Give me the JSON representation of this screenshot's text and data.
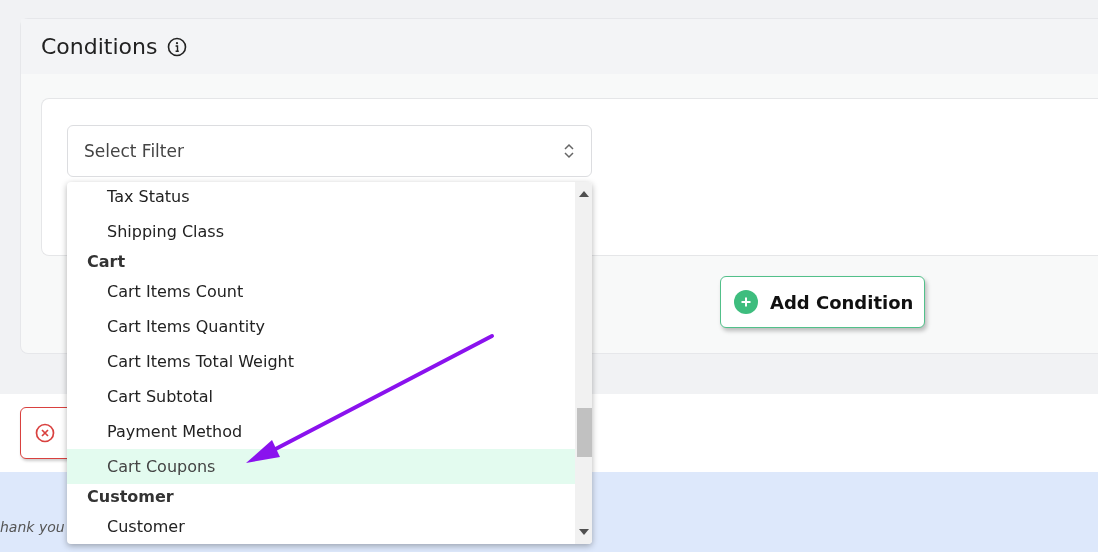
{
  "panel": {
    "title": "Conditions"
  },
  "filter_select": {
    "placeholder": "Select Filter"
  },
  "dropdown_items": [
    {
      "kind": "option",
      "label": "Tax Status",
      "selected": false
    },
    {
      "kind": "option",
      "label": "Shipping Class",
      "selected": false
    },
    {
      "kind": "group",
      "label": "Cart"
    },
    {
      "kind": "option",
      "label": "Cart Items Count",
      "selected": false
    },
    {
      "kind": "option",
      "label": "Cart Items Quantity",
      "selected": false
    },
    {
      "kind": "option",
      "label": "Cart Items Total Weight",
      "selected": false
    },
    {
      "kind": "option",
      "label": "Cart Subtotal",
      "selected": false
    },
    {
      "kind": "option",
      "label": "Payment Method",
      "selected": false
    },
    {
      "kind": "option",
      "label": "Cart Coupons",
      "selected": true
    },
    {
      "kind": "group",
      "label": "Customer"
    },
    {
      "kind": "option",
      "label": "Customer",
      "selected": false
    }
  ],
  "add_button": {
    "label": "Add Condition"
  },
  "footer": {
    "text": "hank you"
  }
}
